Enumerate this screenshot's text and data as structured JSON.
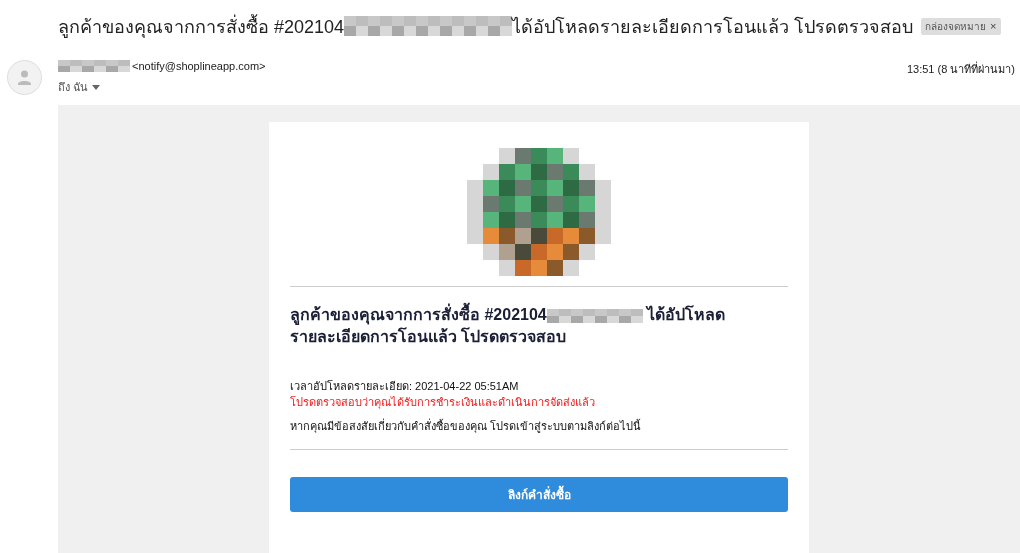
{
  "subject": {
    "parts": [
      {
        "kind": "text",
        "text": "ลูกค้าของคุณจากการสั่งซื้อ #202104"
      },
      {
        "kind": "redacted"
      },
      {
        "kind": "text",
        "text": "ได้อัปโหลดรายละเอียดการโอนแล้ว โปรดตรวจสอบ"
      }
    ],
    "label": "กล่องจดหมาย",
    "label_close": "×"
  },
  "sender": {
    "name_redacted": true,
    "email": "<notify@shoplineapp.com>",
    "to": "ถึง ฉัน",
    "time": "13:51 (8 นาทีที่ผ่านมา)"
  },
  "card": {
    "heading": [
      {
        "kind": "text",
        "text": "ลูกค้าของคุณจากการสั่งซื้อ #202104"
      },
      {
        "kind": "redacted"
      },
      {
        "kind": "text",
        "text": " ได้อัปโหลดรายละเอียดการโอนแล้ว โปรดตรวจสอบ"
      }
    ],
    "upload_time": "เวลาอัปโหลดรายละเอียด: 2021-04-22 05:51AM",
    "warning": "โปรดตรวจสอบว่าคุณได้รับการชำระเงินและดำเนินการจัดส่งแล้ว",
    "note": "หากคุณมีข้อสงสัยเกี่ยวกับคำสั่งซื้อของคุณ โปรดเข้าสู่ระบบตามลิงก์ต่อไปนี้",
    "button": "ลิงก์คำสั่งซื้อ"
  }
}
